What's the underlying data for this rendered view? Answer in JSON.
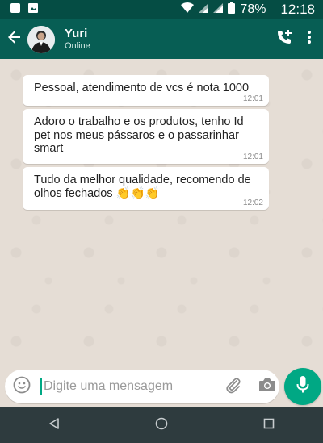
{
  "status_bar": {
    "battery_percent": "78%",
    "time": "12:18",
    "icons": [
      "notification-icon",
      "image-icon",
      "wifi-icon",
      "signal-icon",
      "signal-icon",
      "battery-icon"
    ]
  },
  "header": {
    "contact_name": "Yuri",
    "contact_status": "Online",
    "icons": [
      "back-arrow-icon",
      "add-call-icon",
      "more-vert-icon"
    ]
  },
  "messages": [
    {
      "text": "Pessoal, atendimento de vcs é nota 1000",
      "time": "12:01"
    },
    {
      "text": "Adoro o trabalho e os produtos, tenho Id pet nos meus pássaros e o passarinhar smart",
      "time": "12:01"
    },
    {
      "text": "Tudo da melhor qualidade, recomendo de olhos fechados 👏👏👏",
      "time": "12:02"
    }
  ],
  "composer": {
    "placeholder": "Digite uma mensagem",
    "value": "",
    "icons": [
      "emoji-icon",
      "attach-icon",
      "camera-icon",
      "mic-icon"
    ]
  },
  "colors": {
    "status_bar": "#054d44",
    "app_bar": "#075e54",
    "accent": "#00a884",
    "chat_background": "#e5ddd5",
    "nav_bar": "#2e3b3e"
  }
}
